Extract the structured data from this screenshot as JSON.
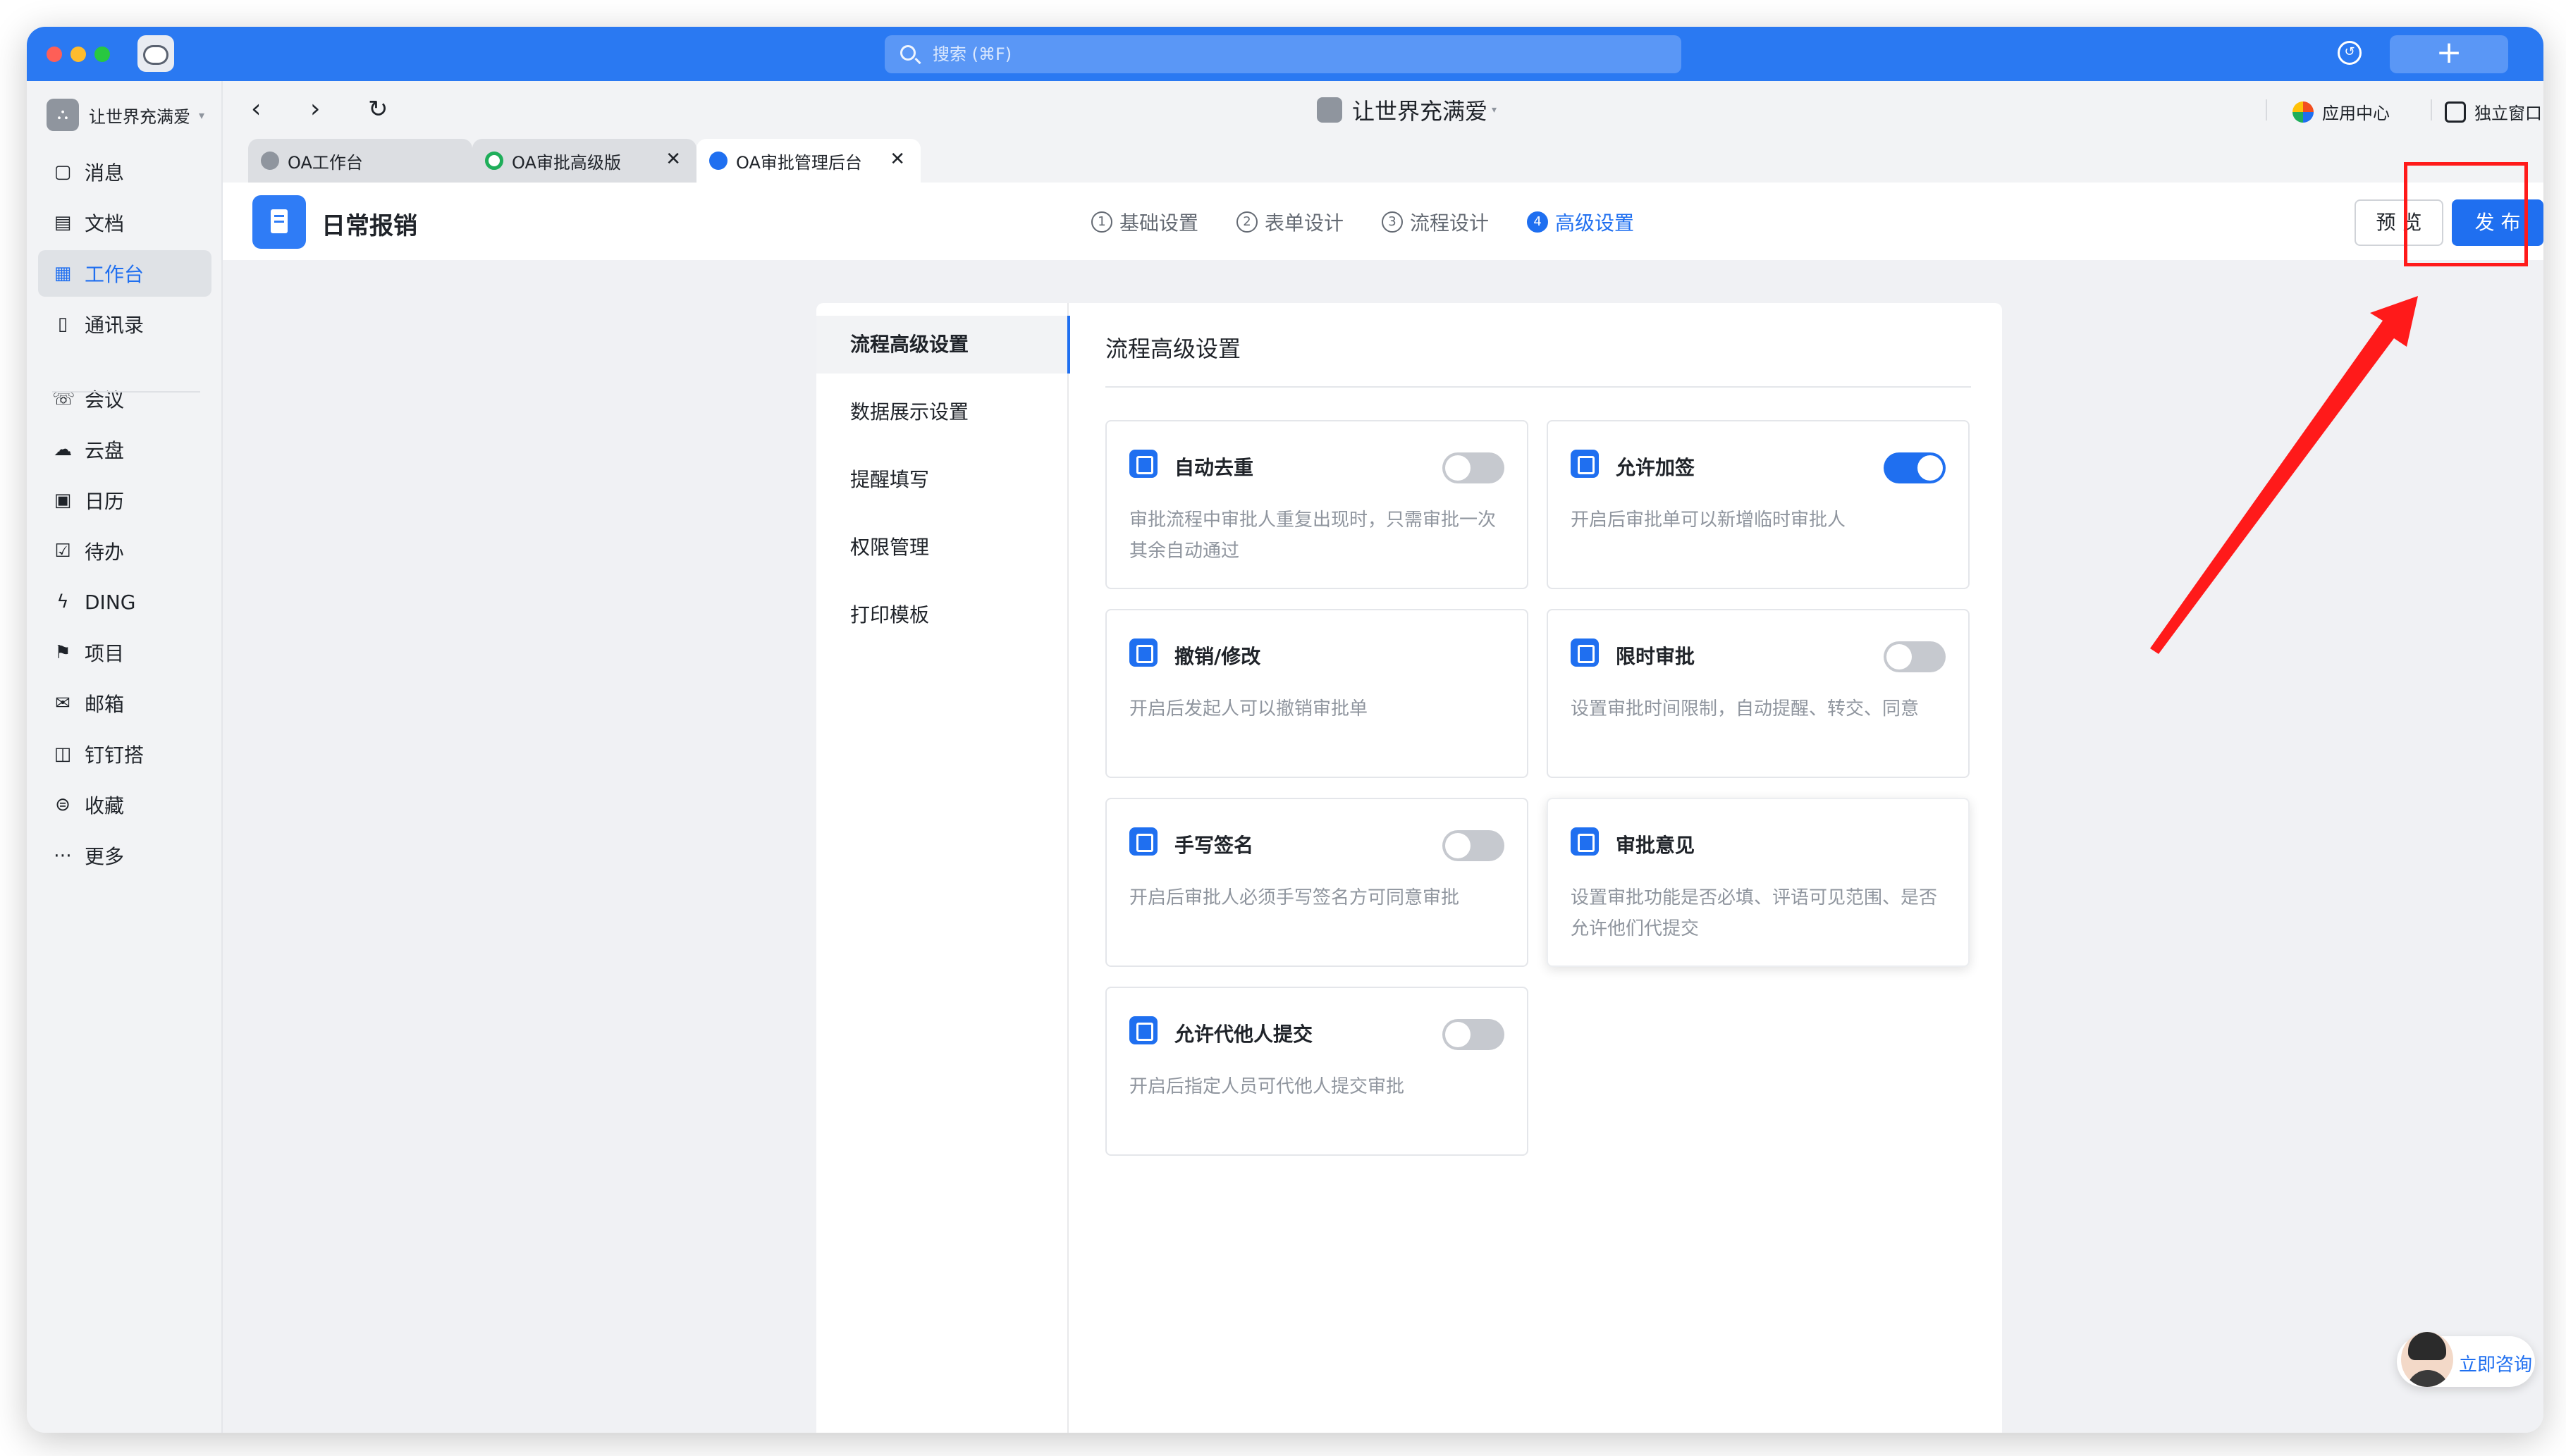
{
  "window": {
    "search_placeholder": "搜索 (⌘F)",
    "plus_label": "+",
    "history_label": "↺"
  },
  "sidebar": {
    "org_name": "让世界充满爱",
    "org_caret": "▾",
    "items": [
      {
        "label": "消息",
        "icon": "message-icon",
        "glyph": "▢",
        "active": false
      },
      {
        "label": "文档",
        "icon": "document-icon",
        "glyph": "▤",
        "active": false
      },
      {
        "label": "工作台",
        "icon": "workbench-icon",
        "glyph": "▦",
        "active": true
      },
      {
        "label": "通讯录",
        "icon": "contacts-icon",
        "glyph": "▯",
        "active": false
      },
      {
        "label": "会议",
        "icon": "meeting-icon",
        "glyph": "☏",
        "active": false
      },
      {
        "label": "云盘",
        "icon": "cloud-drive-icon",
        "glyph": "☁",
        "active": false
      },
      {
        "label": "日历",
        "icon": "calendar-icon",
        "glyph": "▣",
        "active": false
      },
      {
        "label": "待办",
        "icon": "todo-icon",
        "glyph": "☑",
        "active": false
      },
      {
        "label": "DING",
        "icon": "ding-icon",
        "glyph": "ϟ",
        "active": false
      },
      {
        "label": "项目",
        "icon": "project-icon",
        "glyph": "⚑",
        "active": false
      },
      {
        "label": "邮箱",
        "icon": "mail-icon",
        "glyph": "✉",
        "active": false
      },
      {
        "label": "钉钉搭",
        "icon": "dingda-icon",
        "glyph": "◫",
        "active": false
      },
      {
        "label": "收藏",
        "icon": "favorite-icon",
        "glyph": "⊜",
        "active": false
      },
      {
        "label": "更多",
        "icon": "more-icon",
        "glyph": "⋯",
        "active": false
      }
    ]
  },
  "titlebar": {
    "back": "‹",
    "forward": "›",
    "refresh": "↻",
    "center_title": "让世界充满爱",
    "center_caret": "▾",
    "app_center": "应用中心",
    "standalone_window": "独立窗口"
  },
  "tabs": [
    {
      "label": "OA工作台",
      "closable": false,
      "active": false,
      "color": "#8f959e"
    },
    {
      "label": "OA审批高级版",
      "closable": true,
      "active": false,
      "color": "#1fae5a"
    },
    {
      "label": "OA审批管理后台",
      "closable": true,
      "active": true,
      "color": "#1f6ff0"
    }
  ],
  "tab_close": "✕",
  "form": {
    "title": "日常报销",
    "steps": [
      {
        "num": "1",
        "label": "基础设置",
        "active": false
      },
      {
        "num": "2",
        "label": "表单设计",
        "active": false
      },
      {
        "num": "3",
        "label": "流程设计",
        "active": false
      },
      {
        "num": "4",
        "label": "高级设置",
        "active": true
      }
    ],
    "preview_label": "预 览",
    "publish_label": "发 布"
  },
  "panel": {
    "nav": [
      {
        "label": "流程高级设置",
        "active": true
      },
      {
        "label": "数据展示设置",
        "active": false
      },
      {
        "label": "提醒填写",
        "active": false
      },
      {
        "label": "权限管理",
        "active": false
      },
      {
        "label": "打印模板",
        "active": false
      }
    ],
    "title": "流程高级设置",
    "cards": [
      {
        "title": "自动去重",
        "desc": "审批流程中审批人重复出现时，只需审批一次其余自动通过",
        "toggle": "off"
      },
      {
        "title": "允许加签",
        "desc": "开启后审批单可以新增临时审批人",
        "toggle": "on"
      },
      {
        "title": "撤销/修改",
        "desc": "开启后发起人可以撤销审批单",
        "toggle": "none"
      },
      {
        "title": "限时审批",
        "desc": "设置审批时间限制，自动提醒、转交、同意",
        "toggle": "off"
      },
      {
        "title": "手写签名",
        "desc": "开启后审批人必须手写签名方可同意审批",
        "toggle": "off"
      },
      {
        "title": "审批意见",
        "desc": "设置审批功能是否必填、评语可见范围、是否允许他们代提交",
        "toggle": "none"
      },
      {
        "title": "允许代他人提交",
        "desc": "开启后指定人员可代他人提交审批",
        "toggle": "off"
      }
    ]
  },
  "consult_label": "立即咨询",
  "colors": {
    "brand_blue": "#1f6ff0",
    "topbar_blue": "#2a79f2",
    "annotation_red": "#ff1a1a"
  }
}
